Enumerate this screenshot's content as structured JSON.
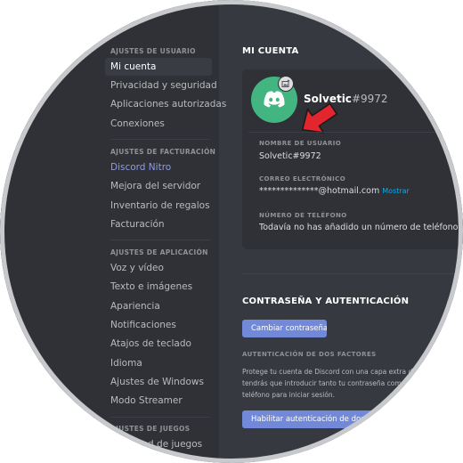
{
  "sidebar": {
    "user_settings_header": "AJUSTES DE USUARIO",
    "user_items": [
      "Mi cuenta",
      "Privacidad y seguridad",
      "Aplicaciones autorizadas",
      "Conexiones"
    ],
    "billing_header": "AJUSTES DE FACTURACIÓN",
    "billing_items": [
      "Discord Nitro",
      "Mejora del servidor",
      "Inventario de regalos",
      "Facturación"
    ],
    "app_header": "AJUSTES DE APLICACIÓN",
    "app_items": [
      "Voz y vídeo",
      "Texto e imágenes",
      "Apariencia",
      "Notificaciones",
      "Atajos de teclado",
      "Idioma",
      "Ajustes de Windows",
      "Modo Streamer"
    ],
    "games_header": "AJUSTES DE JUEGOS",
    "games_items": [
      "Actividad de juegos"
    ]
  },
  "account": {
    "title": "MI CUENTA",
    "username": "Solvetic",
    "discriminator": "#9972",
    "username_label": "NOMBRE DE USUARIO",
    "email_label": "CORREO ELECTRÓNICO",
    "email_value": "**************@hotmail.com",
    "email_reveal": "Mostrar",
    "phone_label": "NÚMERO DE TELÉFONO",
    "phone_value": "Todavía no has añadido un número de teléfono."
  },
  "password": {
    "title": "CONTRASEÑA Y AUTENTICACIÓN",
    "change_button": "Cambiar contraseña",
    "twofa_label": "AUTENTICACIÓN DE DOS FACTORES",
    "twofa_description": [
      "Protege tu cuenta de Discord con una capa extra de",
      "tendrás que introducir tanto tu contraseña como",
      "teléfono para iniciar sesión."
    ],
    "enable_2fa_button": "Habilitar autenticación de dos fa"
  },
  "colors": {
    "sidebar_bg": "#2f3136",
    "main_bg": "#36393f",
    "accent": "#7289da",
    "avatar_bg": "#43b581",
    "arrow": "#e3262e",
    "link": "#00aff4"
  },
  "icons": {
    "avatar": "discord-logo-icon",
    "upload": "image-upload-icon",
    "pointer": "red-arrow-icon"
  }
}
